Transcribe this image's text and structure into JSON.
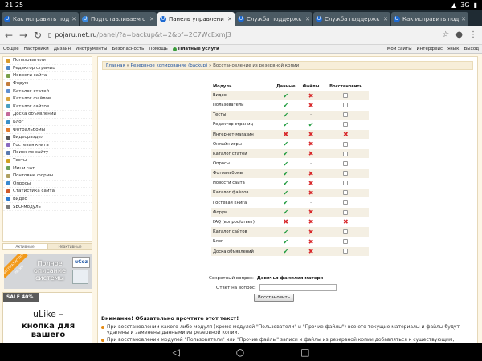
{
  "statusbar": {
    "time": "21:25",
    "network": "3G"
  },
  "tabs": [
    {
      "title": "Как исправить под",
      "color": "#1d6ad2",
      "active": false
    },
    {
      "title": "Подготавливаем с",
      "color": "#3c8ae0",
      "active": false
    },
    {
      "title": "Панель управлени",
      "color": "#1d6ad2",
      "active": true
    },
    {
      "title": "Служба поддержк",
      "color": "#1d6ad2",
      "active": false
    },
    {
      "title": "Служба поддержк",
      "color": "#1d6ad2",
      "active": false
    },
    {
      "title": "Как исправить под",
      "color": "#1d6ad2",
      "active": false
    }
  ],
  "address": {
    "host": "pojaru.net.ru",
    "path": "/panel/?a=backup&t=2&bf=2C7WcExmJ3"
  },
  "ucozbar": {
    "menu": [
      "Общее",
      "Настройки",
      "Дизайн",
      "Инструменты",
      "Безопасность",
      "Помощь"
    ],
    "paid": "Платные услуги",
    "right": [
      "Мои сайты",
      "Интерфейс",
      "Язык",
      "Выход"
    ]
  },
  "sidebar": {
    "items": [
      {
        "label": "Пользователи",
        "color": "#d89a2a"
      },
      {
        "label": "Редактор страниц",
        "color": "#4a86c9"
      },
      {
        "label": "Новости сайта",
        "color": "#7aa04a"
      },
      {
        "label": "Форум",
        "color": "#c47d3a"
      },
      {
        "label": "Каталог статей",
        "color": "#5f8fd0"
      },
      {
        "label": "Каталог файлов",
        "color": "#d9a33a"
      },
      {
        "label": "Каталог сайтов",
        "color": "#4aa0c0"
      },
      {
        "label": "Доска объявлений",
        "color": "#c46a9a"
      },
      {
        "label": "Блог",
        "color": "#3a90c8"
      },
      {
        "label": "Фотоальбомы",
        "color": "#e27a2a"
      },
      {
        "label": "Видеораздел",
        "color": "#555555"
      },
      {
        "label": "Гостевая книга",
        "color": "#8a6ac0"
      },
      {
        "label": "Поиск по сайту",
        "color": "#5a7ab0"
      },
      {
        "label": "Тесты",
        "color": "#d0a020"
      },
      {
        "label": "Мини-чат",
        "color": "#6aa05a"
      },
      {
        "label": "Почтовые формы",
        "color": "#b0a060"
      },
      {
        "label": "Опросы",
        "color": "#3a8ad0"
      },
      {
        "label": "Статистика сайта",
        "color": "#d05a2a"
      },
      {
        "label": "Видео",
        "color": "#2a7ad0"
      },
      {
        "label": "SEO-модуль",
        "color": "#7a7a7a"
      }
    ],
    "tabs": [
      "Активные",
      "Неактивные"
    ]
  },
  "ads": {
    "ad1_ribbon": "БЕСПЛАТНО ПО-ЛЕГКО",
    "ad1_text": "Полное описание системы",
    "ad1_logo": "uCoz",
    "ad2_sale": "SALE 40%",
    "ad2_title": "uLike –",
    "ad2_sub": "кнопка для вашего"
  },
  "breadcrumb": {
    "home": "Главная",
    "section": "Резервное копирование (backup)",
    "current": "Восстановление из резервной копии",
    "sep": "»"
  },
  "table": {
    "headers": [
      "Модуль",
      "Данные",
      "Файлы",
      "Восстановить"
    ],
    "rows": [
      {
        "module": "Видео",
        "data": "ok",
        "files": "no",
        "restore": "cb"
      },
      {
        "module": "Пользователи",
        "data": "ok",
        "files": "no",
        "restore": "cb"
      },
      {
        "module": "Тесты",
        "data": "ok",
        "files": "-",
        "restore": "cb"
      },
      {
        "module": "Редактор страниц",
        "data": "ok",
        "files": "ok",
        "restore": "cb"
      },
      {
        "module": "Интернет-магазин",
        "data": "no",
        "files": "no",
        "restore": "no"
      },
      {
        "module": "Онлайн игры",
        "data": "ok",
        "files": "no",
        "restore": "cb"
      },
      {
        "module": "Каталог статей",
        "data": "ok",
        "files": "no",
        "restore": "cb"
      },
      {
        "module": "Опросы",
        "data": "ok",
        "files": "-",
        "restore": "cb"
      },
      {
        "module": "Фотоальбомы",
        "data": "ok",
        "files": "no",
        "restore": "cb"
      },
      {
        "module": "Новости сайта",
        "data": "ok",
        "files": "no",
        "restore": "cb"
      },
      {
        "module": "Каталог файлов",
        "data": "ok",
        "files": "no",
        "restore": "cb"
      },
      {
        "module": "Гостевая книга",
        "data": "ok",
        "files": "-",
        "restore": "cb"
      },
      {
        "module": "Форум",
        "data": "ok",
        "files": "no",
        "restore": "cb"
      },
      {
        "module": "FAQ (вопрос/ответ)",
        "data": "no",
        "files": "no",
        "restore": "no"
      },
      {
        "module": "Каталог сайтов",
        "data": "ok",
        "files": "no",
        "restore": "cb"
      },
      {
        "module": "Блог",
        "data": "ok",
        "files": "no",
        "restore": "cb"
      },
      {
        "module": "Доска объявлений",
        "data": "ok",
        "files": "no",
        "restore": "cb"
      }
    ]
  },
  "form": {
    "secret_label": "Секретный вопрос:",
    "secret_value": "Девичья фамилия матери",
    "answer_label": "Ответ на вопрос:",
    "answer_value": "",
    "button": "Восстановить"
  },
  "warning": {
    "title": "Внимание! Обязательно прочтите этот текст!",
    "items": [
      "При восстановлении какого-либо модуля (кроме модулей \"Пользователи\" и \"Прочие файлы\") все его текущие материалы и файлы будут удалены и заменены данными из резервной копии.",
      "При восстановлении модулей \"Пользователи\" или \"Прочие файлы\" записи и файлы из резервной копии добавляться к существующим,"
    ]
  }
}
